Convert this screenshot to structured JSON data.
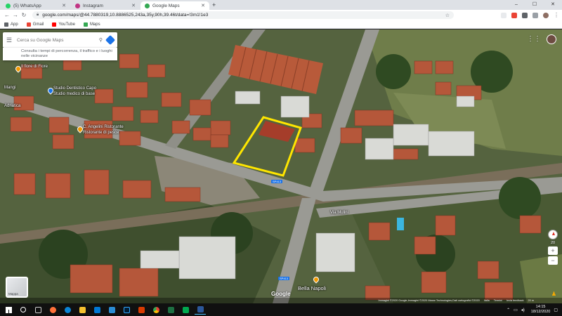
{
  "browser": {
    "tabs": [
      {
        "label": "(5) WhatsApp",
        "color": "#25d366",
        "active": false
      },
      {
        "label": "Instagram",
        "color": "#c13584",
        "active": false
      },
      {
        "label": "Google Maps",
        "color": "#34a853",
        "active": true
      }
    ],
    "new_tab": "+",
    "window_controls": {
      "minimize": "–",
      "maximize": "☐",
      "close": "✕"
    },
    "url": "google.com/maps/@44.7880319,10.8886525,243a,35y,90h,39.46t/data=!3m1!1e3",
    "bookmarks": [
      {
        "label": "App",
        "color": "#5f6368"
      },
      {
        "label": "Gmail",
        "color": "#ea4335"
      },
      {
        "label": "YouTube",
        "color": "#ff0000"
      },
      {
        "label": "Maps",
        "color": "#34a853"
      }
    ]
  },
  "maps": {
    "search_placeholder": "Cerca su Google Maps",
    "hint": "Consulta i tempi di percorrenza, il traffico e i luoghi nelle vicinanze",
    "place_labels": {
      "fiore": "Il fiore di Fiore",
      "adriatica": "Adriatica",
      "capo": "Studio Dentistico Capo",
      "capo_sub": "Studio medico di base",
      "manga": "Mangi",
      "eurovalvole": "C. Angelini Ristorante",
      "eurovalvole_sub": "Ristorante di pesce",
      "via_road": "Via Mulini",
      "bella_napoli": "Bella Napoli",
      "roadsign_1": "SP413",
      "roadsign_2": "SP413"
    },
    "google_logo": "Google",
    "minimap_label": "Mappa",
    "zoom_level": "20",
    "attribution": [
      "Immagini ©2020 Google,Immagini ©2020 Maxar Technologies,Dati cartografici ©2020",
      "Italia",
      "Termini",
      "Invia feedback",
      "20 m"
    ],
    "selection_color": "#ffe600"
  },
  "taskbar": {
    "apps": [
      {
        "name": "search",
        "color": "#ffffff"
      },
      {
        "name": "task-view",
        "color": "#cccccc"
      },
      {
        "name": "firefox",
        "color": "#ff7139"
      },
      {
        "name": "edge",
        "color": "#0a84d6"
      },
      {
        "name": "explorer",
        "color": "#f5c12e"
      },
      {
        "name": "store",
        "color": "#0078d4"
      },
      {
        "name": "mail",
        "color": "#2a8dd4"
      },
      {
        "name": "photoshop",
        "color": "#31a8ff"
      },
      {
        "name": "office",
        "color": "#d83b01"
      },
      {
        "name": "chrome",
        "color": "#4285f4"
      },
      {
        "name": "excel",
        "color": "#1d6f42"
      },
      {
        "name": "green-app",
        "color": "#00a94f"
      },
      {
        "name": "word",
        "color": "#2b579a"
      }
    ],
    "time": "14:15",
    "date": "18/12/2020"
  }
}
